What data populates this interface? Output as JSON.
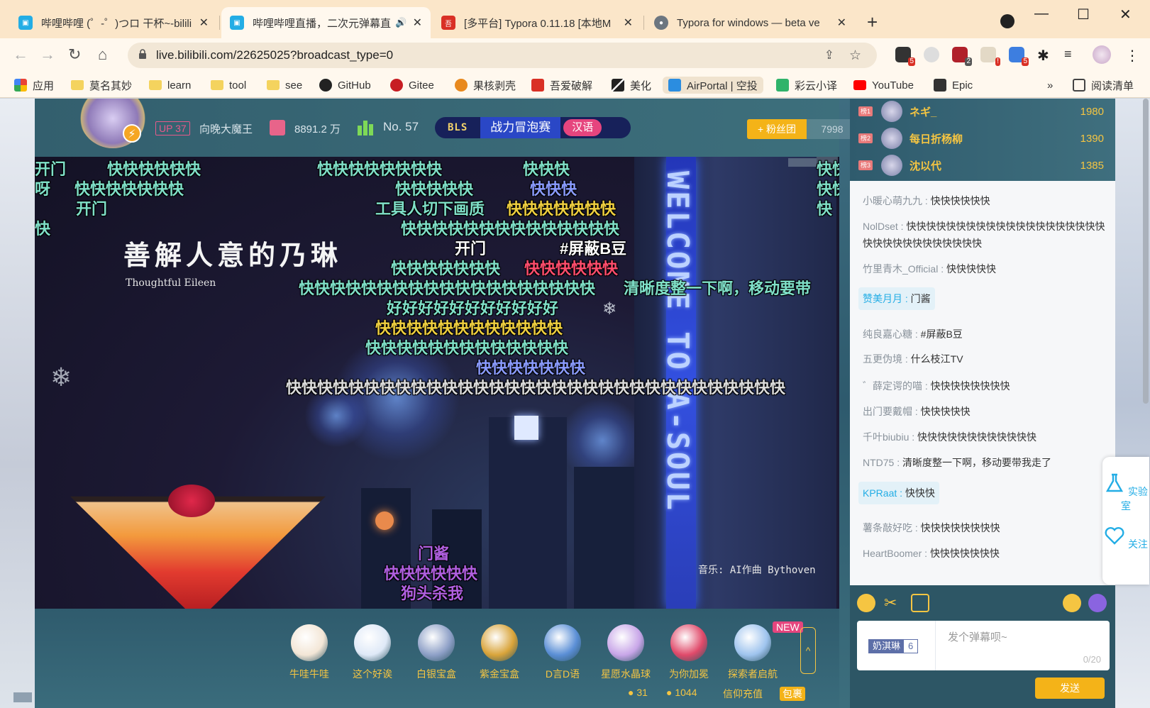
{
  "browser": {
    "tabs": [
      {
        "title": "哔哩哔哩 (゜-゜)つロ 干杯~-bilili",
        "close": "✕"
      },
      {
        "title": "哔哩哔哩直播，二次元弹幕直",
        "close": "✕",
        "sound": "🔊"
      },
      {
        "title": "[多平台] Typora 0.11.18 [本地M",
        "close": "✕"
      },
      {
        "title": "Typora for windows — beta ve",
        "close": "✕"
      }
    ],
    "new_tab": "+",
    "window_controls": {
      "minimize": "—",
      "maximize": "☐",
      "close": "✕"
    },
    "url": "live.bilibili.com/22625025?broadcast_type=0",
    "extension_badges": [
      "5",
      "2",
      "!",
      "5"
    ],
    "bookmarks": [
      "应用",
      "莫名其妙",
      "learn",
      "tool",
      "see",
      "GitHub",
      "Gitee",
      "果核剥壳",
      "吾爱破解",
      "美化",
      "AirPortal | 空投",
      "彩云小译",
      "YouTube",
      "Epic"
    ],
    "bookmarks_more": "»",
    "reading_list": "阅读清单"
  },
  "room": {
    "up_level": "UP 37",
    "up_name": "向晚大魔王",
    "gift_value": "8891.2 万",
    "rank": "No. 57",
    "bls_logo": "BLS",
    "bls_title": "战力冒泡赛",
    "bls_lang": "汉语",
    "fan_button": "+ 粉丝团",
    "fan_count": "7998"
  },
  "video": {
    "lyric_title": "善解人意的乃琳",
    "lyric_sub": "Thoughtful Eileen",
    "music_credit": "音乐:  AI作曲 Bythoven",
    "tower_text": "WELCOME TO A-SOUL",
    "danmaku": [
      {
        "text": "开门",
        "color": "#7fe0c8"
      },
      {
        "text": "快快快快快快",
        "color": "#7fe0c8"
      },
      {
        "text": "快快快快快快快快",
        "color": "#7fe0c8"
      },
      {
        "text": "快快快",
        "color": "#7fe0c8"
      },
      {
        "text": "快快",
        "color": "#7fe0c8"
      },
      {
        "text": "呀",
        "color": "#7fe0c8"
      },
      {
        "text": "快快快快快快快",
        "color": "#7fe0c8"
      },
      {
        "text": "快快快快快",
        "color": "#7fe0c8"
      },
      {
        "text": "快快快",
        "color": "#8a9bff"
      },
      {
        "text": "快快",
        "color": "#7fe0c8"
      },
      {
        "text": "开门",
        "color": "#7fe0c8"
      },
      {
        "text": "工具人切下画质",
        "color": "#7fe0c8"
      },
      {
        "text": "快快快快快快快",
        "color": "#f0d040"
      },
      {
        "text": "快",
        "color": "#7fe0c8"
      },
      {
        "text": "快快快快快快快快快快快快快快",
        "color": "#7fe0c8"
      },
      {
        "text": "快",
        "color": "#7fe0c8"
      },
      {
        "text": "开门",
        "color": "#ffffff"
      },
      {
        "text": "#屏蔽B豆",
        "color": "#ffffff"
      },
      {
        "text": "快快快快快快快",
        "color": "#7fe0c8"
      },
      {
        "text": "快快快快快快",
        "color": "#ff4d6d"
      },
      {
        "text": "快快快快快快快快快快快快快快快快快快快",
        "color": "#7fe0c8"
      },
      {
        "text": "清晰度整一下啊，移动要带",
        "color": "#7fe0c8"
      },
      {
        "text": "好好好好好好好好好好好",
        "color": "#7fe0c8"
      },
      {
        "text": "快快快快快快快快快快快快",
        "color": "#f0d040"
      },
      {
        "text": "快快快快快快快快快快快快快",
        "color": "#7fe0c8"
      },
      {
        "text": "快快快快快快快",
        "color": "#8a9bff"
      },
      {
        "text": "快快快快快快快快快快快快快快快快快快快快快快快快快快快快快快快快",
        "color": "#dddddd"
      },
      {
        "text": "门酱",
        "color": "#b05fe0"
      },
      {
        "text": "快快快快快快",
        "color": "#b05fe0"
      },
      {
        "text": "狗头杀我",
        "color": "#b05fe0"
      }
    ]
  },
  "gifts": [
    {
      "name": "牛哇牛哇",
      "color": "#f3e6d6"
    },
    {
      "name": "这个好诶",
      "color": "#dfe9f7"
    },
    {
      "name": "白银宝盒",
      "color": "#8ea0c7"
    },
    {
      "name": "紫金宝盒",
      "color": "#d9a43a"
    },
    {
      "name": "D言D语",
      "color": "#5b8fd6"
    },
    {
      "name": "星愿水晶球",
      "color": "#c8a6e8"
    },
    {
      "name": "为你加冕",
      "color": "#e04a6a"
    },
    {
      "name": "探索者启航",
      "color": "#9fc4ee"
    }
  ],
  "gift_new_tag": "NEW",
  "gift_expand": "^",
  "wallet": {
    "gold": "31",
    "silver": "1044",
    "recharge": "信仰充值",
    "bag": "包裹"
  },
  "top_rank": [
    {
      "medal": "榜1",
      "name": "ネギ_",
      "score": "1980"
    },
    {
      "medal": "榜2",
      "name": "每日折杨柳",
      "score": "1390"
    },
    {
      "medal": "榜3",
      "name": "沈以代",
      "score": "1385"
    }
  ],
  "chat": [
    {
      "user": "小暖心萌九九",
      "sep": " : ",
      "text": "快快快快快快"
    },
    {
      "user": "NolDset",
      "sep": " : ",
      "text": "快快快快快快快快快快快快快快快快快快快快快快快快快快快快快快快快"
    },
    {
      "user": "竹里青木_Official",
      "sep": " : ",
      "text": "快快快快快"
    },
    {
      "user": "赞美月月",
      "sep": " : ",
      "text": "门酱",
      "highlight": true
    },
    {
      "user": "纯良嘉心糖",
      "sep": " : ",
      "text": "#屏蔽B豆"
    },
    {
      "user": "五更伪境",
      "sep": " : ",
      "text": "什么枝江TV"
    },
    {
      "user": "゛薛定谔的喵",
      "sep": " : ",
      "text": "快快快快快快快快"
    },
    {
      "user": "出门要戴帽",
      "sep": " : ",
      "text": "快快快快快"
    },
    {
      "user": "千叶biubiu",
      "sep": " : ",
      "text": "快快快快快快快快快快快快"
    },
    {
      "user": "NTD75",
      "sep": " : ",
      "text": "清晰度整一下啊，移动要带我走了"
    },
    {
      "user": "KPRaat",
      "sep": " : ",
      "text": "快快快",
      "highlight": true
    },
    {
      "user": "薯条敲好吃",
      "sep": " : ",
      "text": "快快快快快快快快"
    },
    {
      "user": "HeartBoomer",
      "sep": " : ",
      "text": "快快快快快快快"
    }
  ],
  "side": {
    "lab": "实验室",
    "follow": "关注"
  },
  "input": {
    "medal_name": "奶淇琳",
    "medal_level": "6",
    "placeholder": "发个弹幕呗~",
    "counter": "0/20",
    "send": "发送"
  }
}
